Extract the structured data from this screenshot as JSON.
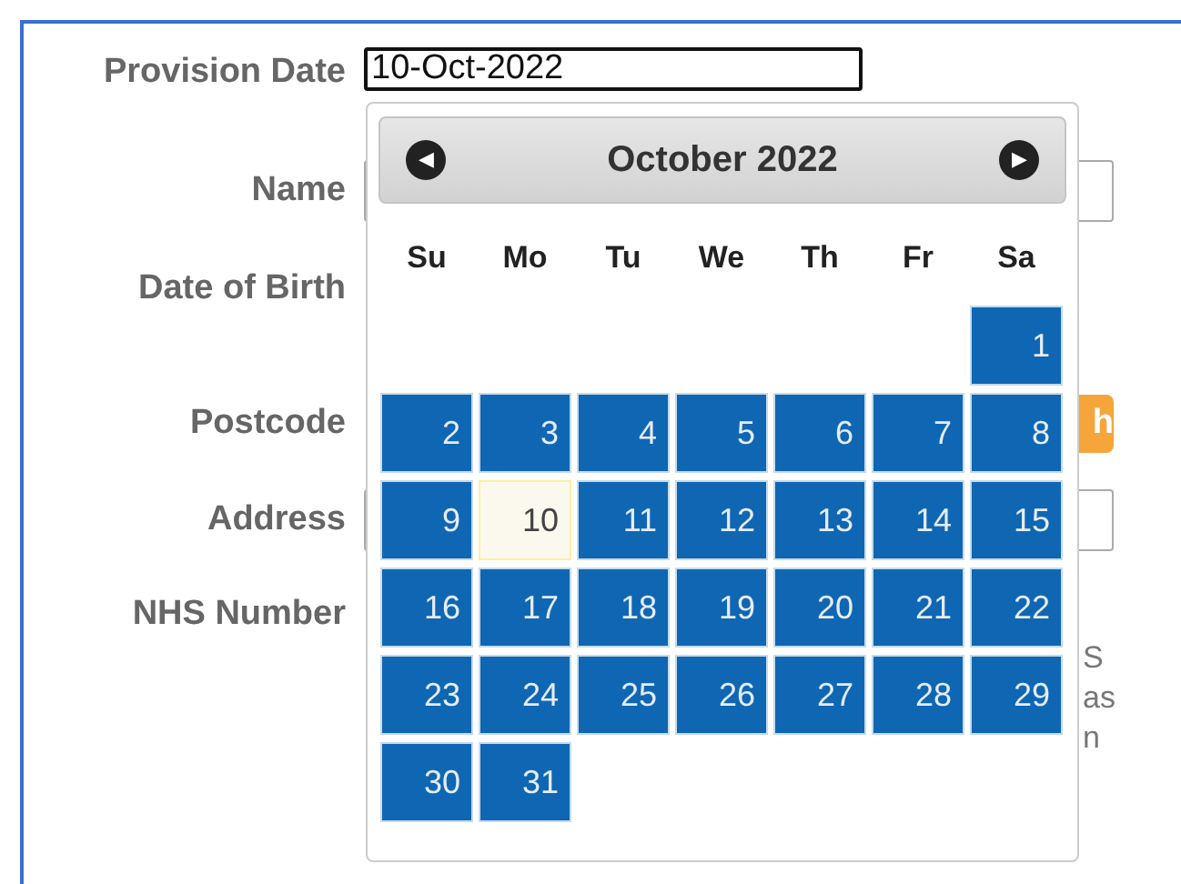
{
  "form": {
    "rows": [
      {
        "label": "Provision Date",
        "kind": "date",
        "value": "10-Oct-2022"
      },
      {
        "label": "Name",
        "kind": "input"
      },
      {
        "label": "Date of Birth",
        "kind": "none"
      },
      {
        "label": "Postcode",
        "kind": "button",
        "button": "h"
      },
      {
        "label": "Address",
        "kind": "input"
      },
      {
        "label": "NHS Number",
        "kind": "note",
        "note": [
          "S",
          "as",
          "n"
        ]
      }
    ]
  },
  "datepicker": {
    "title": "October 2022",
    "prev": "◀",
    "next": "▶",
    "weekdays": [
      "Su",
      "Mo",
      "Tu",
      "We",
      "Th",
      "Fr",
      "Sa"
    ],
    "weeks": [
      [
        {
          "kind": "empty"
        },
        {
          "kind": "empty"
        },
        {
          "kind": "empty"
        },
        {
          "kind": "empty"
        },
        {
          "kind": "empty"
        },
        {
          "kind": "empty"
        },
        {
          "kind": "day",
          "label": "1",
          "selected": false
        }
      ],
      [
        {
          "kind": "day",
          "label": "2",
          "selected": false
        },
        {
          "kind": "day",
          "label": "3",
          "selected": false
        },
        {
          "kind": "day",
          "label": "4",
          "selected": false
        },
        {
          "kind": "day",
          "label": "5",
          "selected": false
        },
        {
          "kind": "day",
          "label": "6",
          "selected": false
        },
        {
          "kind": "day",
          "label": "7",
          "selected": false
        },
        {
          "kind": "day",
          "label": "8",
          "selected": false
        }
      ],
      [
        {
          "kind": "day",
          "label": "9",
          "selected": false
        },
        {
          "kind": "day",
          "label": "10",
          "selected": true
        },
        {
          "kind": "day",
          "label": "11",
          "selected": false
        },
        {
          "kind": "day",
          "label": "12",
          "selected": false
        },
        {
          "kind": "day",
          "label": "13",
          "selected": false
        },
        {
          "kind": "day",
          "label": "14",
          "selected": false
        },
        {
          "kind": "day",
          "label": "15",
          "selected": false
        }
      ],
      [
        {
          "kind": "day",
          "label": "16",
          "selected": false
        },
        {
          "kind": "day",
          "label": "17",
          "selected": false
        },
        {
          "kind": "day",
          "label": "18",
          "selected": false
        },
        {
          "kind": "day",
          "label": "19",
          "selected": false
        },
        {
          "kind": "day",
          "label": "20",
          "selected": false
        },
        {
          "kind": "day",
          "label": "21",
          "selected": false
        },
        {
          "kind": "day",
          "label": "22",
          "selected": false
        }
      ],
      [
        {
          "kind": "day",
          "label": "23",
          "selected": false
        },
        {
          "kind": "day",
          "label": "24",
          "selected": false
        },
        {
          "kind": "day",
          "label": "25",
          "selected": false
        },
        {
          "kind": "day",
          "label": "26",
          "selected": false
        },
        {
          "kind": "day",
          "label": "27",
          "selected": false
        },
        {
          "kind": "day",
          "label": "28",
          "selected": false
        },
        {
          "kind": "day",
          "label": "29",
          "selected": false
        }
      ],
      [
        {
          "kind": "day",
          "label": "30",
          "selected": false
        },
        {
          "kind": "day",
          "label": "31",
          "selected": false
        }
      ]
    ]
  }
}
